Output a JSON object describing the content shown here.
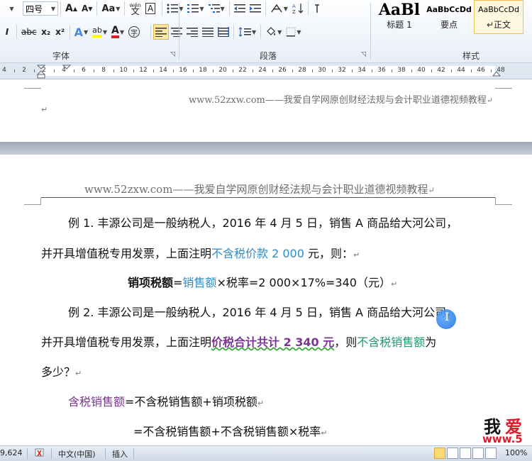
{
  "ribbon": {
    "font_size": "四号",
    "grow_font": "A",
    "shrink_font": "A",
    "change_case": "Aa",
    "phonetic_top": "wén",
    "phonetic_char": "文",
    "char_border": "A",
    "strikethrough": "abc",
    "subscript": "x₂",
    "superscript": "x²",
    "text_effect": "A",
    "highlight": "ab",
    "font_color": "A",
    "enclose_char": "字",
    "group_font": "字体",
    "group_paragraph": "段落",
    "group_styles": "样式",
    "styles": [
      {
        "preview": "AaBl",
        "name": "标题 1"
      },
      {
        "preview": "AaBbCcDd",
        "name": "要点"
      },
      {
        "preview": "AaBbCcDd",
        "name": "↵正文"
      }
    ]
  },
  "ruler": {
    "labels": [
      "4",
      "2",
      "2",
      "4",
      "6",
      "8",
      "10",
      "12",
      "14",
      "16",
      "18",
      "20",
      "22",
      "24",
      "26",
      "28",
      "30",
      "32",
      "34",
      "36",
      "38",
      "40",
      "42",
      "44",
      "46",
      "48"
    ]
  },
  "doc": {
    "header_top": "www.52zxw.com——我爱自学网原创财经法规与会计职业道德视频教程",
    "header_page": "www.52zxw.com——我爱自学网原创财经法规与会计职业道德视频教程",
    "para_mark": "↵",
    "p1a": "例 1.  丰源公司是一般纳税人，2016 年 4 月 5 日，销售 A 商品给大河公司，",
    "p1b_pre": "并开具增值税专用发票，上面注明",
    "p1b_blue": "不含税价款 2 000",
    "p1b_post": " 元，则：",
    "f1_bold": "销项税额",
    "f1_eq": "=",
    "f1_blue": "销售额",
    "f1_rest": "×税率=2 000×17%=340（元）",
    "p2a": "例 2. 丰源公司是一般纳税人，2016 年 4 月 5 日，销售 A 商品给大河公司，",
    "p2b_pre": "并开具增值税专用发票，上面注明",
    "p2b_purple": "价税合计共计 2 340 元",
    "p2b_mid": "，则",
    "p2b_green": "不含税销售额",
    "p2b_post": "为",
    "p2c": "多少？",
    "f2_purple": "含税销售额",
    "f2_rest": "=不含税销售额+销项税额",
    "f3": "=不含税销售额+不含税销售额×税率"
  },
  "logo": {
    "wo": "我",
    "ai": "爱",
    "url": "www.5"
  },
  "status": {
    "word_count": "9,624",
    "language": "中文(中国)",
    "insert_mode": "插入",
    "zoom": "100%"
  }
}
